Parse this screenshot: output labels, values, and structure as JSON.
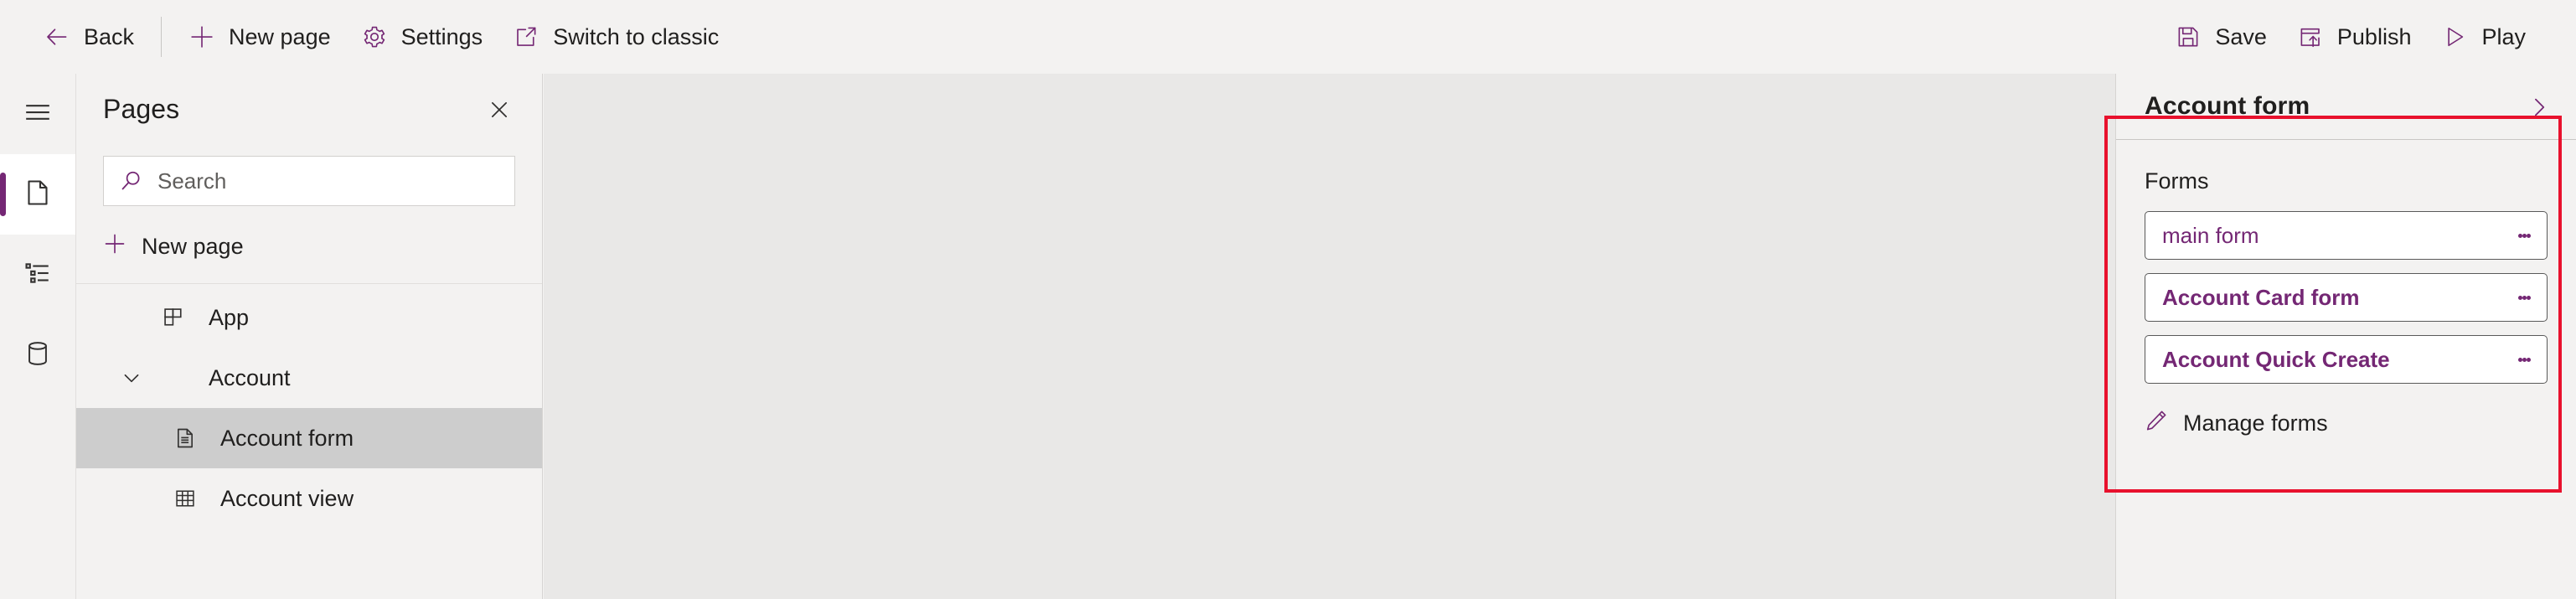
{
  "commandbar": {
    "left_items": [
      {
        "id": "back",
        "label": "Back",
        "icon": "arrow-left-icon"
      },
      {
        "id": "newpage",
        "label": "New page",
        "icon": "plus-icon"
      },
      {
        "id": "settings",
        "label": "Settings",
        "icon": "gear-icon"
      },
      {
        "id": "classic",
        "label": "Switch to classic",
        "icon": "open-in-new-window-icon"
      }
    ],
    "right_items": [
      {
        "id": "save",
        "label": "Save",
        "icon": "save-floppy-icon"
      },
      {
        "id": "publish",
        "label": "Publish",
        "icon": "publish-upload-icon"
      },
      {
        "id": "play",
        "label": "Play",
        "icon": "play-triangle-icon"
      }
    ]
  },
  "rail": {
    "items": [
      {
        "id": "menu",
        "icon": "hamburger-menu-icon",
        "selected": false
      },
      {
        "id": "pages",
        "icon": "page-icon",
        "selected": true
      },
      {
        "id": "navigation",
        "icon": "navigation-list-icon",
        "selected": false
      },
      {
        "id": "data",
        "icon": "database-cylinder-icon",
        "selected": false
      }
    ]
  },
  "pages_panel": {
    "title": "Pages",
    "close_label": "Close",
    "search": {
      "placeholder": "Search",
      "value": ""
    },
    "new_page_label": "New page",
    "tree": [
      {
        "id": "app",
        "label": "App",
        "icon": "app-grid-icon",
        "level": 0,
        "chevron": null,
        "selected": false
      },
      {
        "id": "account",
        "label": "Account",
        "icon": null,
        "level": 0,
        "chevron": "down",
        "selected": false
      },
      {
        "id": "account-form",
        "label": "Account form",
        "icon": "form-page-icon",
        "level": 1,
        "chevron": null,
        "selected": true
      },
      {
        "id": "account-view",
        "label": "Account view",
        "icon": "table-grid-icon",
        "level": 1,
        "chevron": null,
        "selected": false
      }
    ]
  },
  "properties_panel": {
    "title": "Account form",
    "collapse_label": "Collapse",
    "section_label": "Forms",
    "forms": [
      {
        "id": "main-form",
        "label": "main form",
        "bold": false
      },
      {
        "id": "account-card-form",
        "label": "Account Card form",
        "bold": true
      },
      {
        "id": "account-quick-create",
        "label": "Account Quick Create",
        "bold": true
      }
    ],
    "manage_forms_label": "Manage forms",
    "manage_forms_icon": "pencil-edit-icon",
    "card_menu_icon": "more-vertical-icon"
  },
  "colors": {
    "accent_purple": "#742774",
    "annotation_red": "#e8112d",
    "chrome_bg": "#f3f2f1",
    "canvas_bg": "#e9e8e7",
    "selected_row": "#cdcdcd"
  }
}
